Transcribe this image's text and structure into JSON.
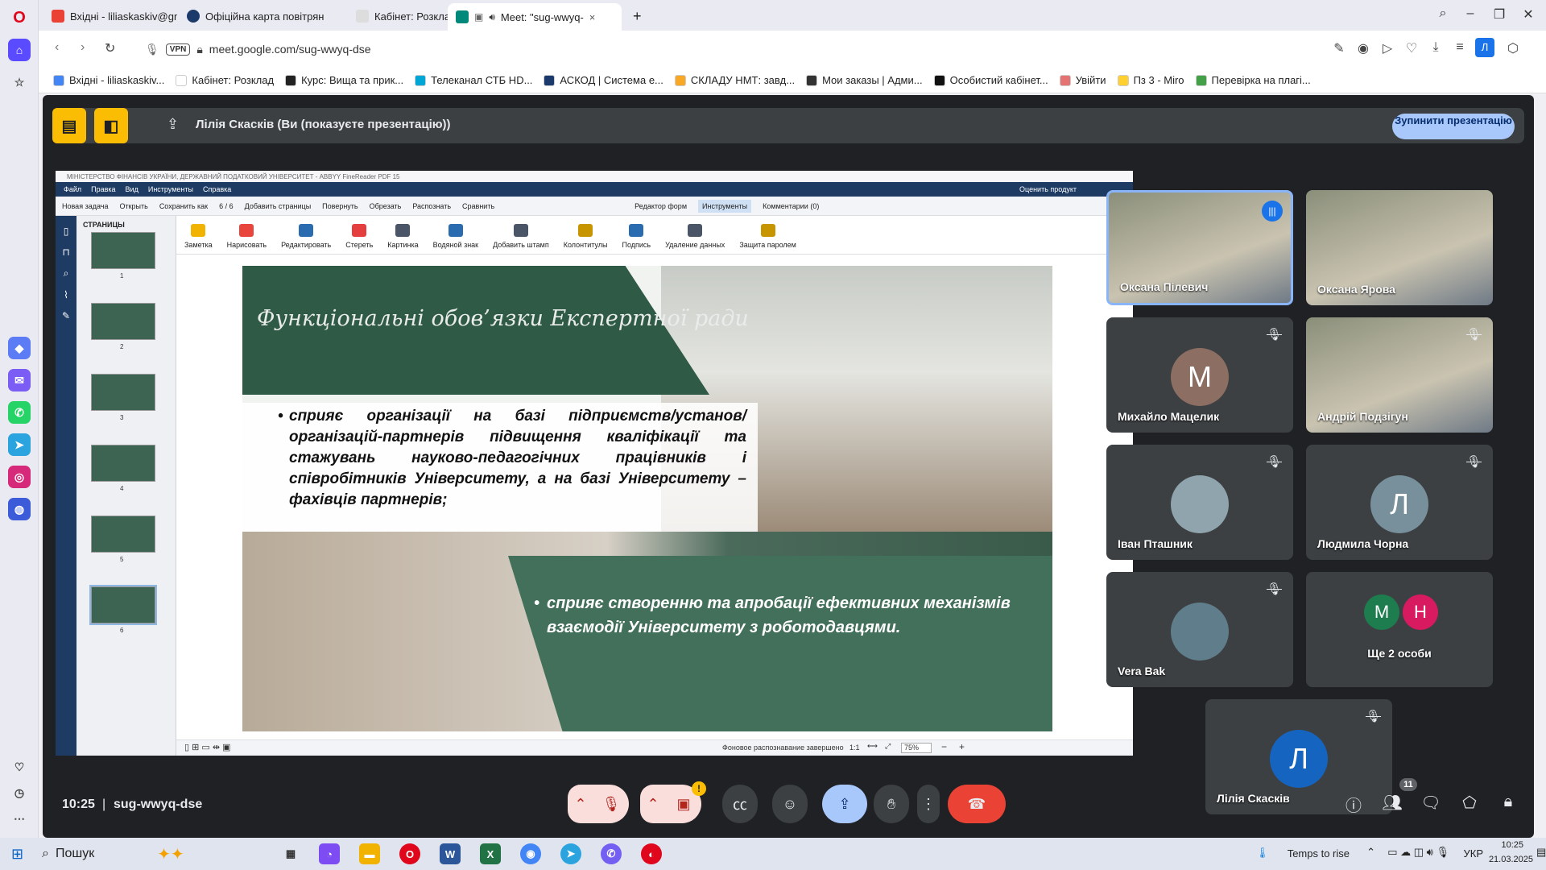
{
  "browser": {
    "tabs": [
      {
        "label": "Вхідні - liliaskaskiv@gmai",
        "color": "#ea4335"
      },
      {
        "label": "Офіційна карта повітрян",
        "color": "#1b3a6b"
      },
      {
        "label": "Кабінет: Розклад",
        "color": "#cccccc"
      },
      {
        "label": "Meet: \"sug-wwyq-",
        "color": "#00897b"
      }
    ],
    "new_tab": "+",
    "address": "meet.google.com/sug-wwyq-dse",
    "vpn": "VPN",
    "profile_initial": "Л",
    "bookmarks": [
      {
        "label": "Вхідні - liliaskaskiv...",
        "color": "#4285f4"
      },
      {
        "label": "Кабінет: Розклад",
        "color": "#ffffff"
      },
      {
        "label": "Курс: Вища та прик...",
        "color": "#222222"
      },
      {
        "label": "Телеканал СТБ HD...",
        "color": "#00a6d6"
      },
      {
        "label": "АСКОД | Система е...",
        "color": "#1b3a6b"
      },
      {
        "label": "СКЛАДУ НМТ: завд...",
        "color": "#f9a825"
      },
      {
        "label": "Мои заказы | Адми...",
        "color": "#333333"
      },
      {
        "label": "Особистий кабінет...",
        "color": "#111111"
      },
      {
        "label": "Увійти",
        "color": "#e57373"
      },
      {
        "label": "Пз 3 - Miro",
        "color": "#ffd02f"
      },
      {
        "label": "Перевірка на плагі...",
        "color": "#43a047"
      }
    ]
  },
  "meet": {
    "presenting_text": "Лілія Скасків (Ви (показуєте презентацію))",
    "stop_button": "Зупинити презентацію",
    "time": "10:25",
    "code": "sug-wwyq-dse",
    "people_count": "11",
    "participants": [
      {
        "name": "Оксана Пілевич",
        "initial": "",
        "speaking": true,
        "video": true,
        "color": ""
      },
      {
        "name": "Оксана Ярова",
        "initial": "",
        "speaking": false,
        "video": true,
        "color": ""
      },
      {
        "name": "Михайло Мацелик",
        "initial": "M",
        "speaking": false,
        "video": false,
        "color": "#8d6e63"
      },
      {
        "name": "Андрій Подзігун",
        "initial": "",
        "speaking": false,
        "video": true,
        "color": ""
      },
      {
        "name": "Іван Пташник",
        "initial": "",
        "speaking": false,
        "video": false,
        "color": "#90a4ae"
      },
      {
        "name": "Людмила Чорна",
        "initial": "Л",
        "speaking": false,
        "video": false,
        "color": "#78909c"
      },
      {
        "name": "Vera Bak",
        "initial": "",
        "speaking": false,
        "video": false,
        "color": "#607d8b"
      },
      {
        "name": "Ще 2 особи",
        "initial": "",
        "speaking": false,
        "video": false,
        "color": ""
      },
      {
        "name": "Лілія Скасків",
        "initial": "Л",
        "speaking": false,
        "video": false,
        "color": "#1565c0"
      }
    ],
    "more_initials": [
      "M",
      "H"
    ]
  },
  "shared_screen": {
    "window_title": "МІНІСТЕРСТВО ФІНАНСІВ УКРАЇНИ, ДЕРЖАВНИЙ ПОДАТКОВИЙ УНІВЕРСИТЕТ - ABBYY FineReader PDF 15",
    "menu": [
      "Файл",
      "Правка",
      "Вид",
      "Инструменты",
      "Справка"
    ],
    "menu_right": "Оценить продукт",
    "toolbar1": [
      "Новая задача",
      "Открыть",
      "Сохранить как",
      "6 / 6",
      "Добавить страницы",
      "Повернуть",
      "Обрезать",
      "Распознать",
      "Сравнить",
      "Редактор форм",
      "Инструменты",
      "Комментарии (0)"
    ],
    "toolbar2": [
      "Заметка",
      "Нарисовать",
      "Редактировать",
      "Стереть",
      "Картинка",
      "Водяной знак",
      "Добавить штамп",
      "Колонтитулы",
      "Подпись",
      "Удаление данных",
      "Защита паролем"
    ],
    "pages_header": "СТРАНИЦЫ",
    "page_numbers": [
      "1",
      "2",
      "3",
      "4",
      "5",
      "6"
    ],
    "status_text": "Фоновое распознавание завершено",
    "zoom": "75%",
    "ratio": "1:1",
    "slide": {
      "title": "Функціональні обов’язки Експертної ради",
      "bullet1": "сприяє організації на базі підприємств/установ/організацій-партнерів підвищення кваліфікації та стажувань науково-педагогічних працівників і співробітників Університету, а на базі Університету – фахівців партнерів;",
      "bullet2": "сприяє створенню та апробації ефективних механізмів взаємодії Університету з роботодавцями."
    }
  },
  "taskbar": {
    "search": "Пошук",
    "weather": "Temps to rise",
    "lang": "УКР",
    "time": "10:25",
    "date": "21.03.2025"
  }
}
